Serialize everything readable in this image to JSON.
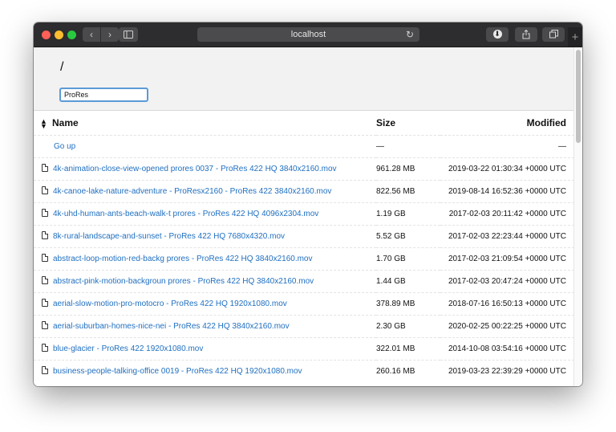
{
  "browser": {
    "address": "localhost",
    "back_glyph": "‹",
    "forward_glyph": "›",
    "reload_glyph": "↻",
    "newtab_glyph": "+"
  },
  "listing": {
    "path": "/",
    "filter_value": "ProRes",
    "columns": {
      "name": "Name",
      "size": "Size",
      "modified": "Modified"
    },
    "go_up": {
      "label": "Go up",
      "size": "—",
      "modified": "—"
    },
    "files": [
      {
        "name": "4k-animation-close-view-opened prores 0037 - ProRes 422 HQ 3840x2160.mov",
        "size": "961.28 MB",
        "modified": "2019-03-22 01:30:34 +0000 UTC"
      },
      {
        "name": "4k-canoe-lake-nature-adventure - ProResx2160 - ProRes 422 3840x2160.mov",
        "size": "822.56 MB",
        "modified": "2019-08-14 16:52:36 +0000 UTC"
      },
      {
        "name": "4k-uhd-human-ants-beach-walk-t prores - ProRes 422 HQ 4096x2304.mov",
        "size": "1.19 GB",
        "modified": "2017-02-03 20:11:42 +0000 UTC"
      },
      {
        "name": "8k-rural-landscape-and-sunset - ProRes 422 HQ 7680x4320.mov",
        "size": "5.52 GB",
        "modified": "2017-02-03 22:23:44 +0000 UTC"
      },
      {
        "name": "abstract-loop-motion-red-backg prores - ProRes 422 HQ 3840x2160.mov",
        "size": "1.70 GB",
        "modified": "2017-02-03 21:09:54 +0000 UTC"
      },
      {
        "name": "abstract-pink-motion-backgroun prores - ProRes 422 HQ 3840x2160.mov",
        "size": "1.44 GB",
        "modified": "2017-02-03 20:47:24 +0000 UTC"
      },
      {
        "name": "aerial-slow-motion-pro-motocro - ProRes 422 HQ 1920x1080.mov",
        "size": "378.89 MB",
        "modified": "2018-07-16 16:50:13 +0000 UTC"
      },
      {
        "name": "aerial-suburban-homes-nice-nei - ProRes 422 HQ 3840x2160.mov",
        "size": "2.30 GB",
        "modified": "2020-02-25 00:22:25 +0000 UTC"
      },
      {
        "name": "blue-glacier - ProRes 422 1920x1080.mov",
        "size": "322.01 MB",
        "modified": "2014-10-08 03:54:16 +0000 UTC"
      },
      {
        "name": "business-people-talking-office 0019 - ProRes 422 HQ 1920x1080.mov",
        "size": "260.16 MB",
        "modified": "2019-03-23 22:39:29 +0000 UTC"
      }
    ]
  }
}
